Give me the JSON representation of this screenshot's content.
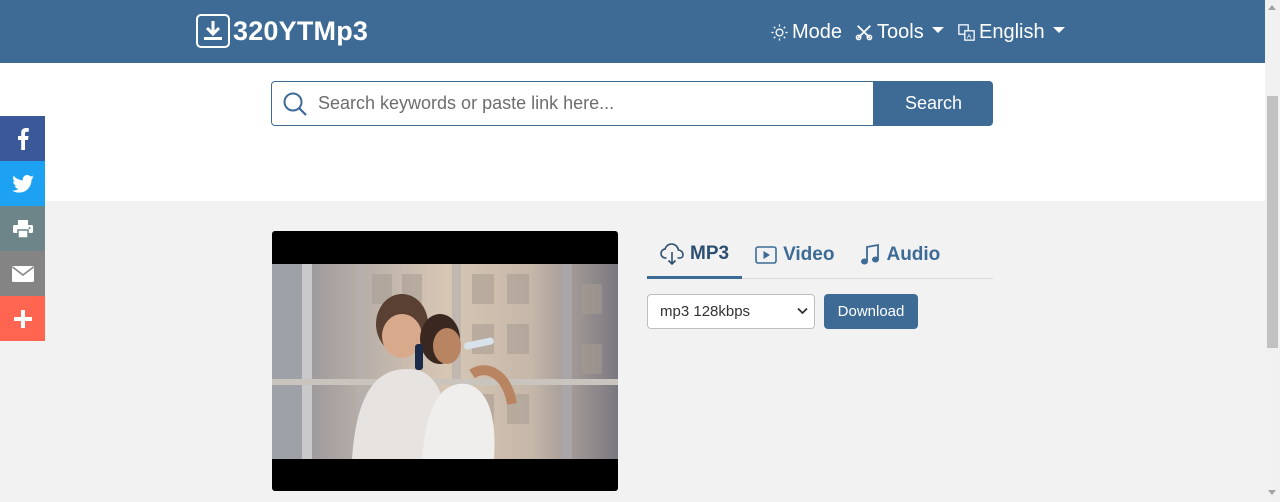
{
  "header": {
    "brand": "320YTMp3",
    "mode_label": "Mode",
    "tools_label": "Tools",
    "language_label": "English"
  },
  "search": {
    "placeholder": "Search keywords or paste link here...",
    "button_label": "Search"
  },
  "share": {
    "items": [
      "facebook",
      "twitter",
      "print",
      "email",
      "more"
    ],
    "colors": {
      "facebook": "#3b5998",
      "twitter": "#1da1f2",
      "print": "#6d8489",
      "email": "#848484",
      "more": "#ff6550"
    }
  },
  "tabs": [
    {
      "label": "MP3",
      "icon": "cloud-download-icon",
      "active": true
    },
    {
      "label": "Video",
      "icon": "video-play-icon",
      "active": false
    },
    {
      "label": "Audio",
      "icon": "music-note-icon",
      "active": false
    }
  ],
  "quality": {
    "selected": "mp3 128kbps"
  },
  "download": {
    "button_label": "Download"
  },
  "colors": {
    "primary": "#3d6b96",
    "background": "#f2f2f2"
  }
}
